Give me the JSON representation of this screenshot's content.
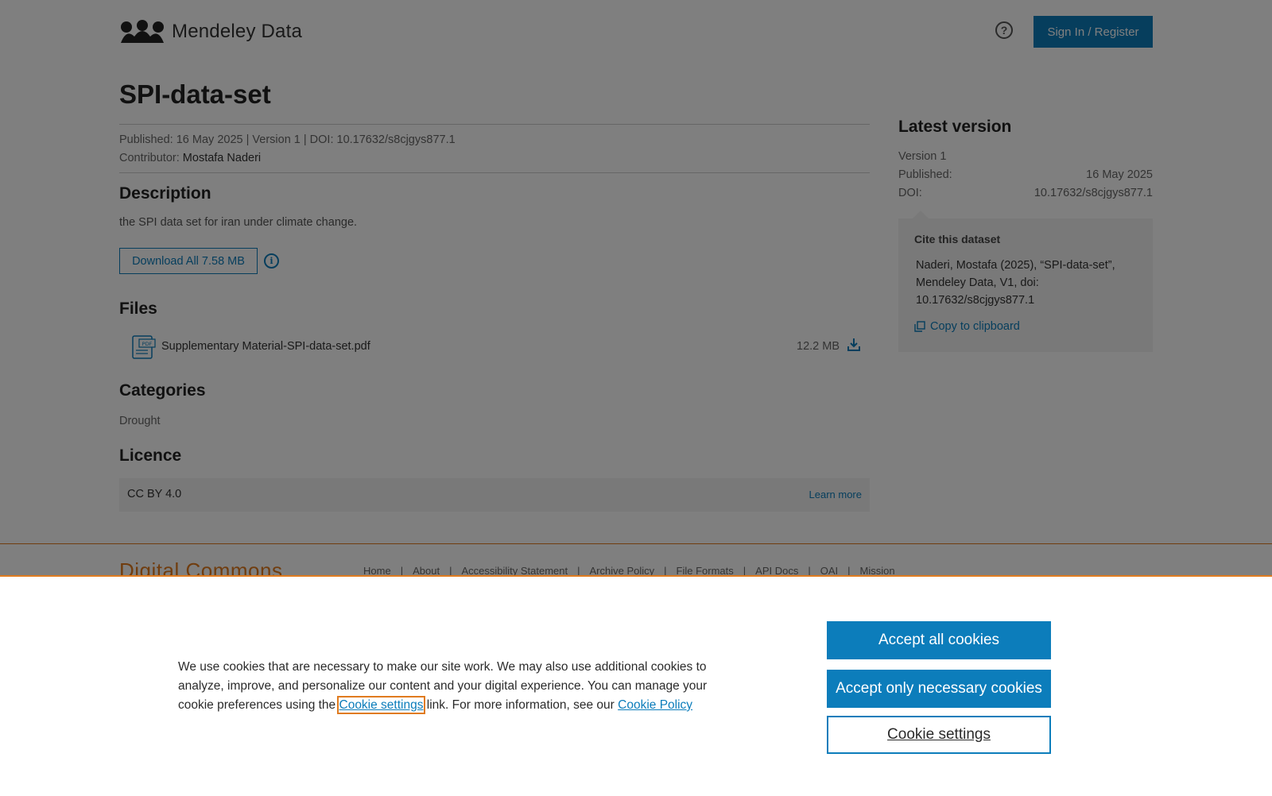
{
  "header": {
    "brand": "Mendeley Data",
    "help_icon": "question-circle-icon",
    "signin_label": "Sign In / Register"
  },
  "dataset": {
    "title": "SPI-data-set",
    "meta_line": "Published: 16 May 2025 | Version 1 | DOI: 10.17632/s8cjgys877.1",
    "contributor_label": "Contributor:",
    "contributor_name": "Mostafa Naderi"
  },
  "description": {
    "heading": "Description",
    "text": "the SPI data set for iran under climate change.",
    "download_label": "Download All 7.58 MB",
    "info_icon": "info-icon"
  },
  "files": {
    "heading": "Files",
    "items": [
      {
        "name": "Supplementary Material-SPI-data-set.pdf",
        "size": "12.2 MB",
        "icon": "pdf-file-icon"
      }
    ]
  },
  "categories": {
    "heading": "Categories",
    "items": [
      "Drought"
    ]
  },
  "licence": {
    "heading": "Licence",
    "name": "CC BY 4.0",
    "learn_more": "Learn more"
  },
  "sidebar": {
    "heading": "Latest version",
    "version": "Version 1",
    "published_label": "Published:",
    "published_value": "16 May 2025",
    "doi_label": "DOI:",
    "doi_value": "10.17632/s8cjgys877.1",
    "cite_heading": "Cite this dataset",
    "cite_text": "Naderi, Mostafa (2025), “SPI-data-set”, Mendeley Data, V1, doi: 10.17632/s8cjgys877.1",
    "copy_label": "Copy to clipboard"
  },
  "footer": {
    "brand": "Digital Commons",
    "links": [
      "Home",
      "About",
      "Accessibility Statement",
      "Archive Policy",
      "File Formats",
      "API Docs",
      "OAI",
      "Mission"
    ]
  },
  "cookie_banner": {
    "text_before": "We use cookies that are necessary to make our site work. We may also use additional cookies to analyze, improve, and personalize our content and your digital experience. You can manage your cookie preferences using the",
    "settings_link": "Cookie settings",
    "text_middle": "link. For more information, see our",
    "policy_link": "Cookie Policy",
    "accept_all": "Accept all cookies",
    "accept_necessary": "Accept only necessary cookies",
    "settings_button": "Cookie settings"
  },
  "colors": {
    "brand_blue": "#0c7dbb",
    "accent_orange": "#e07b1f",
    "overlay": "rgba(0,0,0,0.5)"
  }
}
